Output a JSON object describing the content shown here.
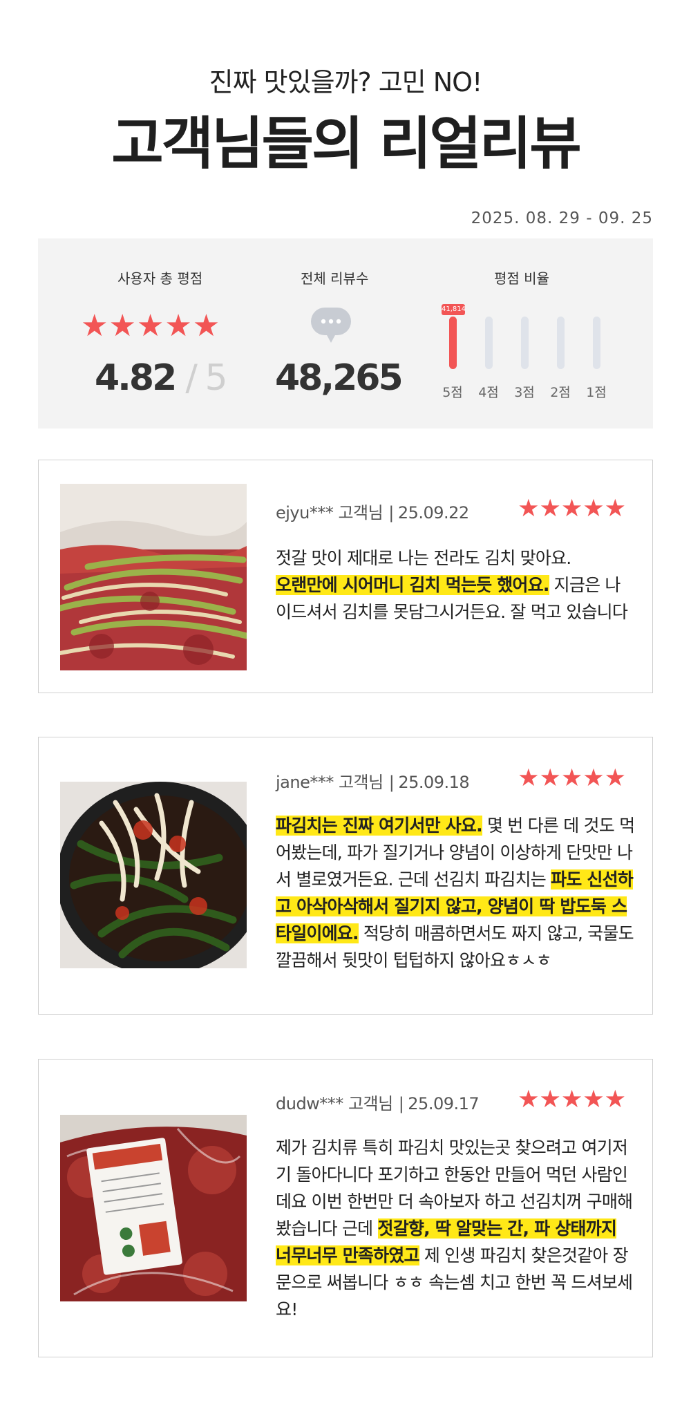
{
  "header": {
    "subtitle": "진짜 맛있을까? 고민 NO!",
    "title": "고객님들의 리얼리뷰"
  },
  "period": "2025. 08. 29 - 09. 25",
  "summary": {
    "rating_label": "사용자 총 평점",
    "stars": "★★★★★",
    "score": "4.82",
    "score_max": "/ 5",
    "count_label": "전체 리뷰수",
    "count_icon": "speech-bubble-icon",
    "count": "48,265",
    "ratio_label": "평점 비율",
    "ratio": [
      {
        "label": "5점",
        "fill": 1.0,
        "badge": "41,814"
      },
      {
        "label": "4점",
        "fill": 0.0
      },
      {
        "label": "3점",
        "fill": 0.0
      },
      {
        "label": "2점",
        "fill": 0.0
      },
      {
        "label": "1점",
        "fill": 0.0
      }
    ]
  },
  "reviews": [
    {
      "user": "ejyu*** 고객님",
      "separator": "|",
      "date": "25.09.22",
      "stars": "★★★★★",
      "text1": "젓갈 맛이 제대로 나는 전라도 김치 맞아요.",
      "hl1": "오랜만에 시어머니 김치 먹는듯 했어요.",
      "text2": " 지금은 나이드셔서 김치를 못담그시거든요. 잘 먹고 있습니다"
    },
    {
      "user": "jane*** 고객님",
      "separator": "|",
      "date": "25.09.18",
      "stars": "★★★★★",
      "hl1": "파김치는 진짜 여기서만 사요.",
      "text1": " 몇 번 다른 데 것도 먹어봤는데, 파가 질기거나 양념이 이상하게 단맛만 나서 별로였거든요. 근데 선김치 파김치는 ",
      "hl2": "파도 신선하고 아삭아삭해서 질기지 않고, 양념이 딱 밥도둑 스타일이에요.",
      "text2": " 적당히 매콤하면서도 짜지 않고, 국물도 깔끔해서 뒷맛이 텁텁하지 않아요ㅎㅅㅎ"
    },
    {
      "user": "dudw*** 고객님",
      "separator": "|",
      "date": "25.09.17",
      "stars": "★★★★★",
      "text1": "제가 김치류 특히 파김치 맛있는곳 찾으려고 여기저기 돌아다니다 포기하고 한동안 만들어 먹던 사람인데요 이번 한번만 더 속아보자 하고 선김치꺼 구매해봤습니다 근데 ",
      "hl1": "젓갈향, 딱 알맞는 간, 파 상태까지 너무너무 만족하였고",
      "text2": "  제 인생 파김치 찾은것같아 장문으로 써봅니다 ㅎㅎ 속는셈 치고 한번 꼭 드셔보세요!"
    }
  ]
}
